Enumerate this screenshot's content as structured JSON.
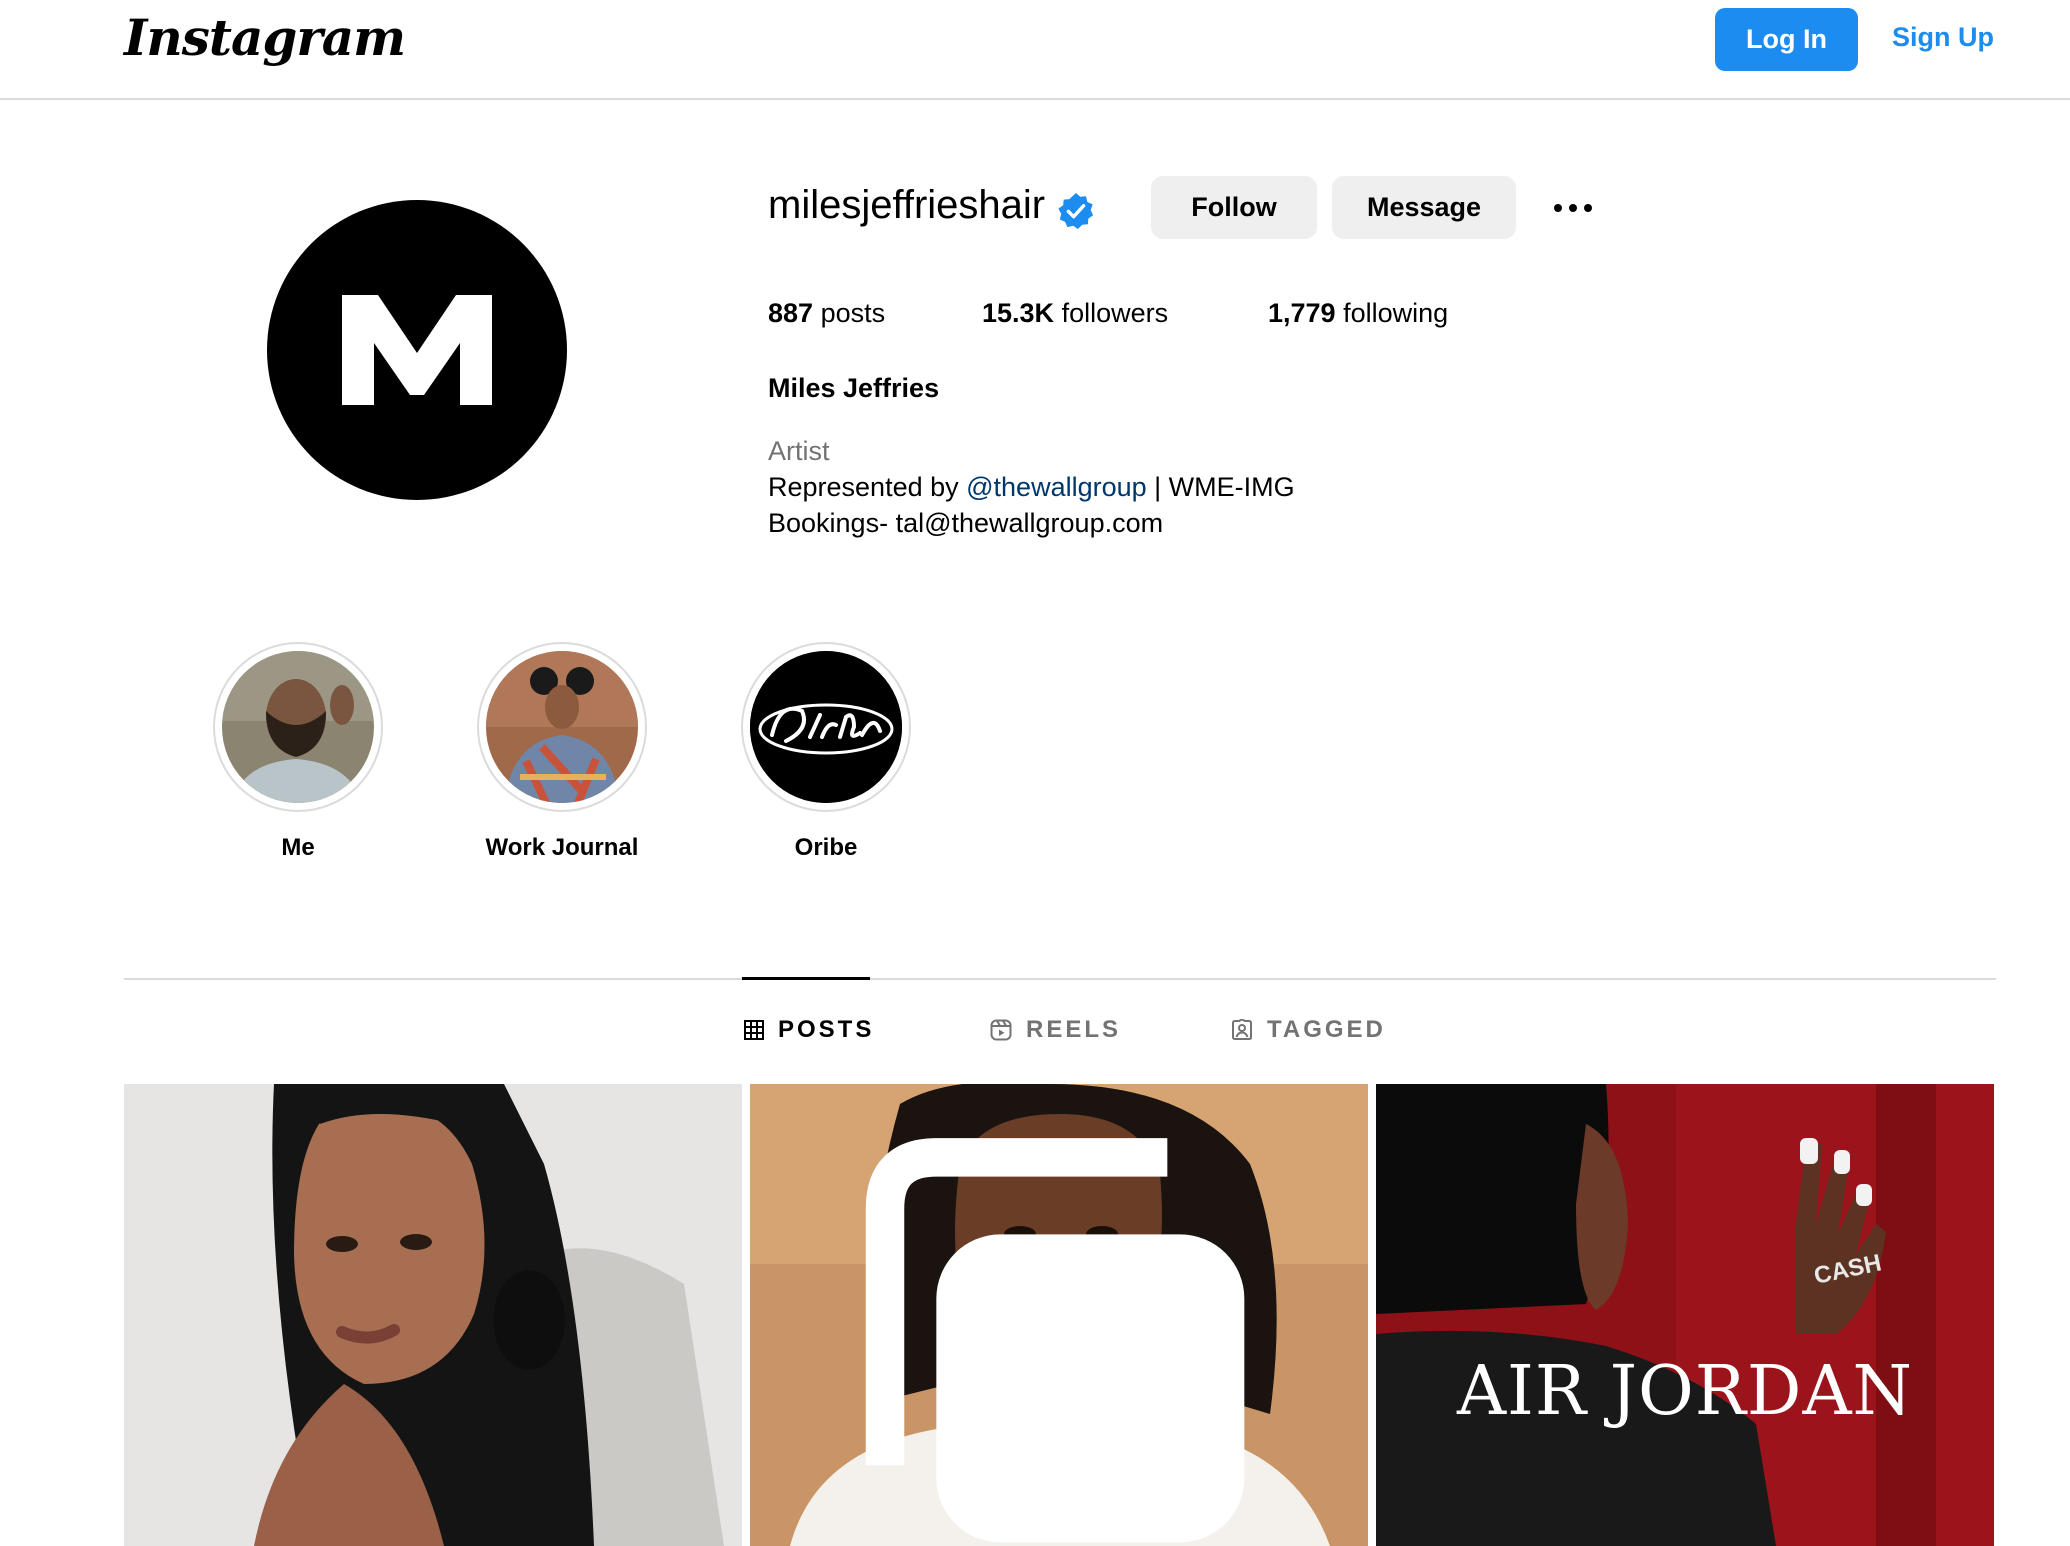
{
  "header": {
    "logo_text": "Instagram",
    "login_label": "Log In",
    "signup_label": "Sign Up",
    "accent_color": "#1c8cf0"
  },
  "profile": {
    "avatar_letter": "M",
    "username": "milesjeffrieshair",
    "verified": true,
    "follow_label": "Follow",
    "message_label": "Message",
    "more_icon": "more-options-icon",
    "stats": {
      "posts_count": "887",
      "posts_label": "posts",
      "followers_count": "15.3K",
      "followers_label": "followers",
      "following_count": "1,779",
      "following_label": "following"
    },
    "full_name": "Miles Jeffries",
    "category": "Artist",
    "bio": {
      "line1_prefix": "Represented by ",
      "line1_link": "@thewallgroup",
      "line1_suffix": " | WME-IMG",
      "line2": "Bookings- tal@thewallgroup.com"
    }
  },
  "highlights": [
    {
      "label": "Me"
    },
    {
      "label": "Work Journal"
    },
    {
      "label": "Oribe"
    }
  ],
  "tabs": [
    {
      "label": "POSTS",
      "icon": "grid-icon",
      "active": true
    },
    {
      "label": "REELS",
      "icon": "reels-icon",
      "active": false
    },
    {
      "label": "TAGGED",
      "icon": "tagged-icon",
      "active": false
    }
  ],
  "posts": [
    {
      "caption": ""
    },
    {
      "caption": "",
      "icon": "multiple-photos-icon"
    },
    {
      "caption": "AIR JORDAN"
    }
  ]
}
